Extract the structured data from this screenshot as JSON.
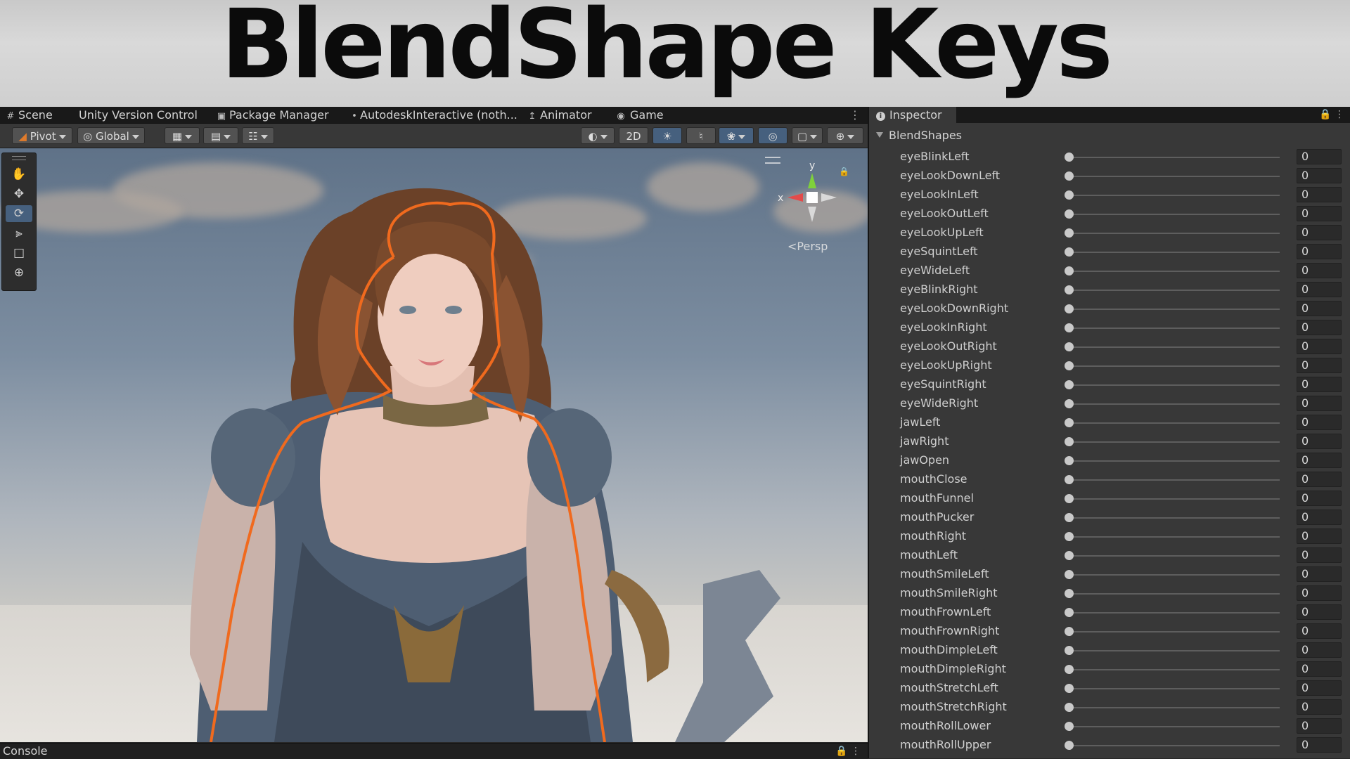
{
  "banner": {
    "title": "BlendShape Keys"
  },
  "tabs": [
    {
      "label": "Scene",
      "icon": "grid-icon"
    },
    {
      "label": "Unity Version Control",
      "icon": ""
    },
    {
      "label": "Package Manager",
      "icon": "package-icon"
    },
    {
      "label": "AutodeskInteractive (noth...",
      "icon": "dot-icon"
    },
    {
      "label": "Animator",
      "icon": "animator-icon"
    },
    {
      "label": "Game",
      "icon": "gamepad-icon"
    }
  ],
  "toolbar": {
    "pivot_label": "Pivot",
    "global_label": "Global",
    "mode_2d_label": "2D"
  },
  "scene": {
    "persp_label": "<Persp",
    "axis_y": "y",
    "axis_x": "x"
  },
  "console": {
    "label": "Console"
  },
  "inspector": {
    "tab_label": "Inspector",
    "section_title": "BlendShapes",
    "blendshapes": [
      {
        "name": "eyeBlinkLeft",
        "value": "0"
      },
      {
        "name": "eyeLookDownLeft",
        "value": "0"
      },
      {
        "name": "eyeLookInLeft",
        "value": "0"
      },
      {
        "name": "eyeLookOutLeft",
        "value": "0"
      },
      {
        "name": "eyeLookUpLeft",
        "value": "0"
      },
      {
        "name": "eyeSquintLeft",
        "value": "0"
      },
      {
        "name": "eyeWideLeft",
        "value": "0"
      },
      {
        "name": "eyeBlinkRight",
        "value": "0"
      },
      {
        "name": "eyeLookDownRight",
        "value": "0"
      },
      {
        "name": "eyeLookInRight",
        "value": "0"
      },
      {
        "name": "eyeLookOutRight",
        "value": "0"
      },
      {
        "name": "eyeLookUpRight",
        "value": "0"
      },
      {
        "name": "eyeSquintRight",
        "value": "0"
      },
      {
        "name": "eyeWideRight",
        "value": "0"
      },
      {
        "name": "jawLeft",
        "value": "0"
      },
      {
        "name": "jawRight",
        "value": "0"
      },
      {
        "name": "jawOpen",
        "value": "0"
      },
      {
        "name": "mouthClose",
        "value": "0"
      },
      {
        "name": "mouthFunnel",
        "value": "0"
      },
      {
        "name": "mouthPucker",
        "value": "0"
      },
      {
        "name": "mouthRight",
        "value": "0"
      },
      {
        "name": "mouthLeft",
        "value": "0"
      },
      {
        "name": "mouthSmileLeft",
        "value": "0"
      },
      {
        "name": "mouthSmileRight",
        "value": "0"
      },
      {
        "name": "mouthFrownLeft",
        "value": "0"
      },
      {
        "name": "mouthFrownRight",
        "value": "0"
      },
      {
        "name": "mouthDimpleLeft",
        "value": "0"
      },
      {
        "name": "mouthDimpleRight",
        "value": "0"
      },
      {
        "name": "mouthStretchLeft",
        "value": "0"
      },
      {
        "name": "mouthStretchRight",
        "value": "0"
      },
      {
        "name": "mouthRollLower",
        "value": "0"
      },
      {
        "name": "mouthRollUpper",
        "value": "0"
      }
    ]
  },
  "colors": {
    "accent_blue": "#46607e",
    "selection_outline": "#f06a1e"
  }
}
